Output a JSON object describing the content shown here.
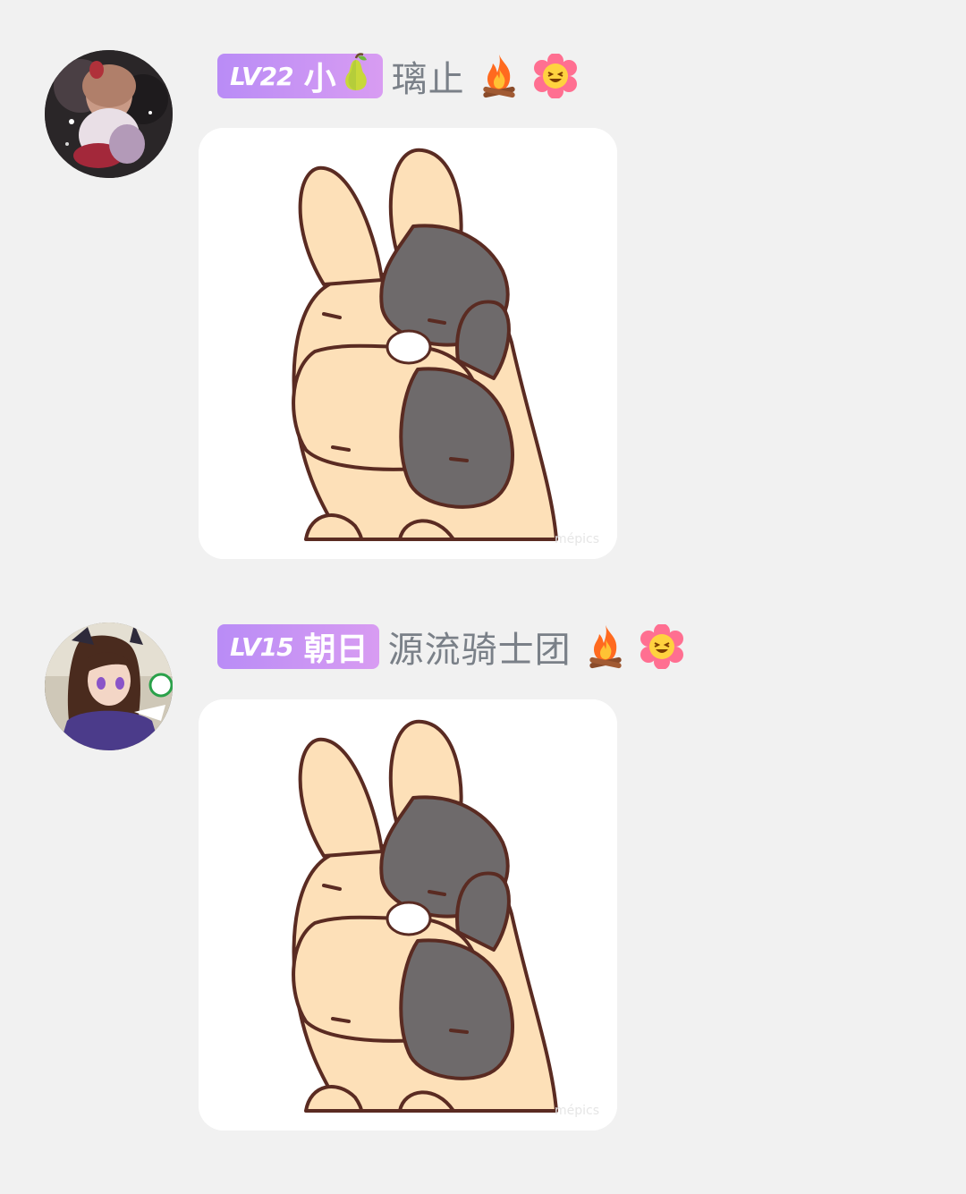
{
  "messages": [
    {
      "level": "LV22",
      "title": "小",
      "title_icon": "pear-icon",
      "username": "璃止",
      "emojis": [
        "fire-icon",
        "grinning-flower-icon"
      ],
      "sticker": "bunny-sticker-image",
      "watermark": "mépics"
    },
    {
      "level": "LV15",
      "title": "朝日",
      "username": "源流骑士团",
      "emojis": [
        "fire-icon",
        "grinning-flower-icon"
      ],
      "sticker": "bunny-sticker-image",
      "watermark": "mépics"
    }
  ],
  "colors": {
    "background": "#f1f1f1",
    "badge_start": "#b98cf6",
    "badge_end": "#d89cf2",
    "username": "#7a8088"
  }
}
